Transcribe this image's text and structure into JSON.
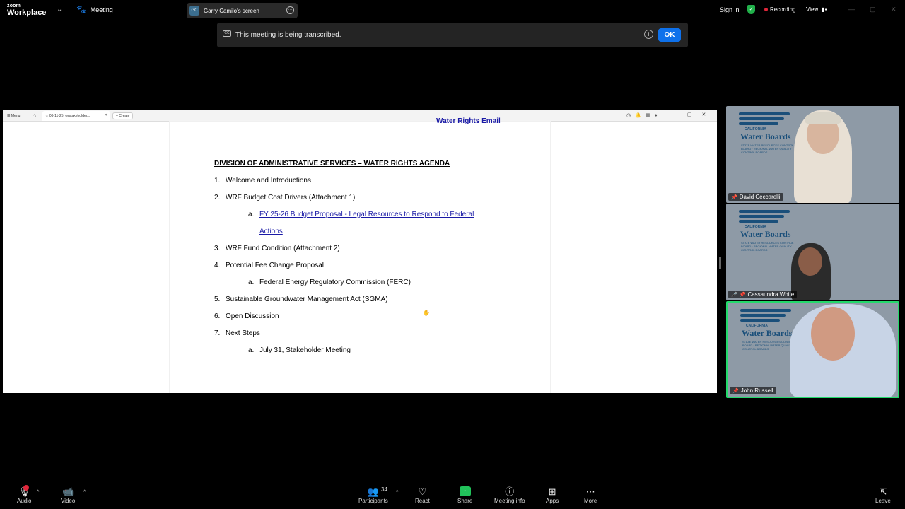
{
  "topbar": {
    "logo_line1": "zoom",
    "logo_line2": "Workplace",
    "meeting_label": "Meeting",
    "screen_initials": "GC",
    "screen_label": "Garry Camilo's screen",
    "signin": "Sign in",
    "recording": "Recording",
    "view": "View"
  },
  "banner": {
    "cc_label": "CC",
    "text": "This meeting is being transcribed.",
    "ok": "OK"
  },
  "shared_screen": {
    "tabbar": {
      "menu": "☰ Menu",
      "tab_title": "06-11-25_wrstakeholder...",
      "create": "+ Create"
    },
    "doc": {
      "top_link": "Water Rights Email",
      "heading": "DIVISION OF ADMINISTRATIVE SERVICES – WATER RIGHTS AGENDA",
      "items": [
        {
          "num": "1.",
          "text": "Welcome and Introductions"
        },
        {
          "num": "2.",
          "text": "WRF Budget Cost Drivers (Attachment 1)"
        },
        {
          "num": "a.",
          "text": "FY 25-26 Budget Proposal - Legal Resources to Respond to Federal"
        },
        {
          "num": "",
          "text": "Actions"
        },
        {
          "num": "3.",
          "text": "WRF Fund Condition (Attachment 2)"
        },
        {
          "num": "4.",
          "text": "Potential Fee Change Proposal"
        },
        {
          "num": "a.",
          "text": "Federal Energy Regulatory Commission (FERC)"
        },
        {
          "num": "5.",
          "text": "Sustainable Groundwater Management Act (SGMA)"
        },
        {
          "num": "6.",
          "text": "Open Discussion"
        },
        {
          "num": "7.",
          "text": "Next Steps"
        },
        {
          "num": "a.",
          "text": "July 31, Stakeholder Meeting"
        }
      ]
    }
  },
  "participants_video": [
    {
      "name": "David Ceccarelli",
      "logo_cal": "CALIFORNIA",
      "logo_title": "Water Boards",
      "logo_sub": "STATE WATER RESOURCES CONTROL BOARD · REGIONAL WATER QUALITY CONTROL BOARDS"
    },
    {
      "name": "Cassaundra White",
      "logo_cal": "CALIFORNIA",
      "logo_title": "Water Boards",
      "logo_sub": "STATE WATER RESOURCES CONTROL BOARD · REGIONAL WATER QUALITY CONTROL BOARDS"
    },
    {
      "name": "John Russell",
      "logo_cal": "CALIFORNIA",
      "logo_title": "Water Boards",
      "logo_sub": "STATE WATER RESOURCES CONTROL BOARD · REGIONAL WATER QUALITY CONTROL BOARDS"
    }
  ],
  "toolbar": {
    "audio": "Audio",
    "video": "Video",
    "participants": "Participants",
    "participants_count": "34",
    "react": "React",
    "share": "Share",
    "meeting_info": "Meeting info",
    "apps": "Apps",
    "more": "More",
    "leave": "Leave"
  },
  "colors": {
    "accent": "#0e71eb",
    "share_green": "#21c25a",
    "active_speaker": "#23d96b",
    "recording_red": "#e0263a"
  }
}
